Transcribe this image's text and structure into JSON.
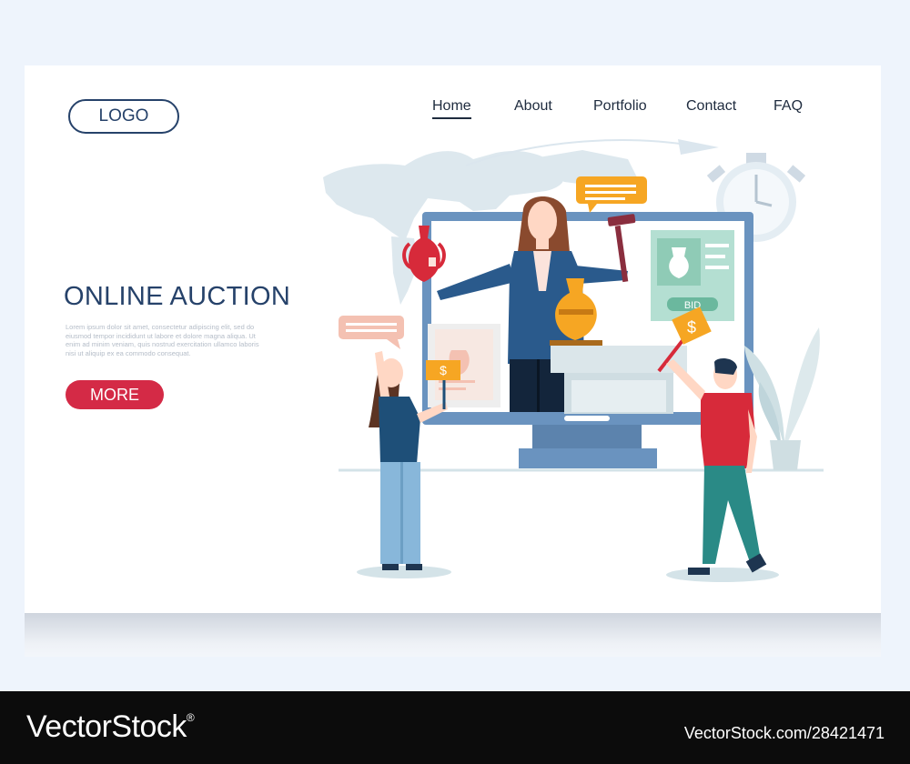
{
  "logo": {
    "label": "LOGO"
  },
  "nav": {
    "items": [
      "Home",
      "About",
      "Portfolio",
      "Contact",
      "FAQ"
    ],
    "active": "Home"
  },
  "hero": {
    "title": "ONLINE AUCTION",
    "body": "Lorem ipsum dolor sit amet, consectetur adipiscing elit, sed do eiusmod tempor incididunt ut labore et dolore magna aliqua. Ut enim ad minim veniam, quis nostrud exercitation ullamco laboris nisi ut aliquip ex ea commodo consequat.",
    "button": "MORE"
  },
  "illustration": {
    "bid_label": "BID",
    "currency_symbol": "$",
    "icons": [
      "world-map-icon",
      "stopwatch-icon",
      "computer-monitor-icon",
      "auctioneer-figure",
      "gavel-icon",
      "vase-icon",
      "speech-bubble-icon",
      "plant-icon",
      "bidder-figure"
    ]
  },
  "colors": {
    "brand_navy": "#26426a",
    "accent_red": "#d42a46",
    "monitor_blue": "#6a93bf",
    "speech_orange": "#f6a623",
    "page_bg": "#eef4fc"
  },
  "footer": {
    "brand": "VectorStock",
    "registered": "®",
    "stock_id": "VectorStock.com/28421471"
  }
}
